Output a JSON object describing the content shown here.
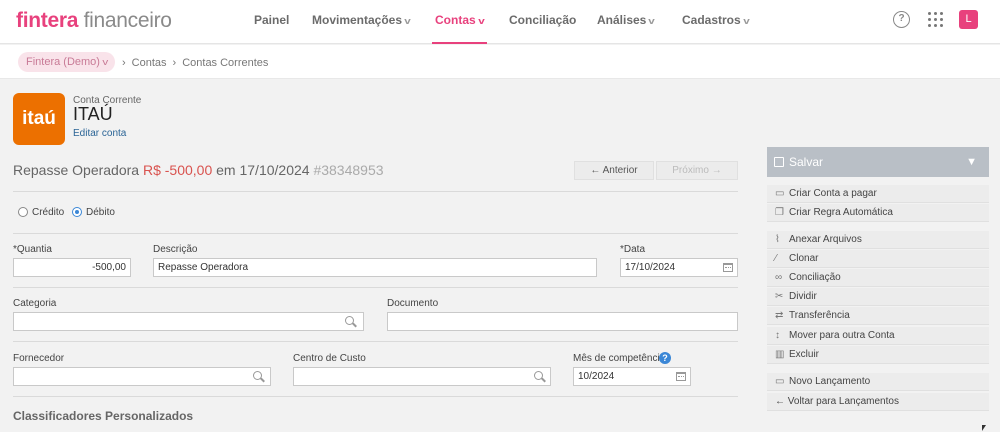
{
  "app": {
    "brand": "fintera",
    "suffix": " financeiro"
  },
  "nav": {
    "items": [
      {
        "label": "Painel",
        "dropdown": false,
        "active": false
      },
      {
        "label": "Movimentações",
        "dropdown": true,
        "active": false
      },
      {
        "label": "Contas",
        "dropdown": true,
        "active": true
      },
      {
        "label": "Conciliação",
        "dropdown": false,
        "active": false
      },
      {
        "label": "Análises",
        "dropdown": true,
        "active": false
      },
      {
        "label": "Cadastros",
        "dropdown": true,
        "active": false
      }
    ],
    "help_icon": "?",
    "avatar": "L"
  },
  "breadcrumb": {
    "company": "Fintera (Demo)",
    "items": [
      "Contas",
      "Contas Correntes"
    ]
  },
  "account": {
    "logo_text": "itaú",
    "type": "Conta Corrente",
    "name": "ITAÚ",
    "edit_link": "Editar conta"
  },
  "transaction": {
    "name": "Repasse Operadora",
    "amount": "R$ -500,00",
    "date_prefix": "em",
    "date": "17/10/2024",
    "id": "#38348953"
  },
  "pager": {
    "previous": "← Anterior",
    "next": "Próximo →"
  },
  "type_radio": {
    "credit": "Crédito",
    "debit": "Débito",
    "selected": "debit"
  },
  "form": {
    "quantity_label": "*Quantia",
    "quantity_value": "-500,00",
    "description_label": "Descrição",
    "description_value": "Repasse Operadora",
    "date_label": "*Data",
    "date_value": "17/10/2024",
    "category_label": "Categoria",
    "category_value": "",
    "document_label": "Documento",
    "document_value": "",
    "supplier_label": "Fornecedor",
    "supplier_value": "",
    "cost_center_label": "Centro de Custo",
    "cost_center_value": "",
    "competence_label": "Mês de competência",
    "competence_value": "10/2024"
  },
  "custom_classifiers": "Classificadores Personalizados",
  "actions": {
    "save": "Salvar",
    "create_payable": "Criar Conta a pagar",
    "create_rule": "Criar Regra Automática",
    "attach": "Anexar Arquivos",
    "clone": "Clonar",
    "reconcile": "Conciliação",
    "split": "Dividir",
    "transfer": "Transferência",
    "move": "Mover para outra Conta",
    "delete": "Excluir",
    "new_entry": "Novo Lançamento",
    "back": "← Voltar para Lançamentos"
  },
  "colors": {
    "brand": "#e8417d",
    "itau_orange": "#ec7000",
    "negative": "#d9534f",
    "link": "#2a6496",
    "save_bg": "#b9bfc6"
  }
}
